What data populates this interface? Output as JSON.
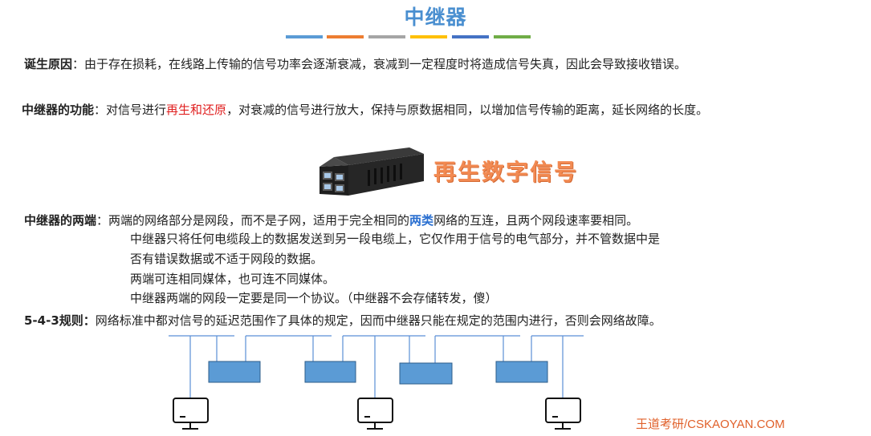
{
  "title": "中继器",
  "stripe_colors": [
    "#5b9bd5",
    "#ed7d31",
    "#a5a5a5",
    "#ffc000",
    "#4472c4",
    "#70ad47"
  ],
  "origin": {
    "label": "诞生原因",
    "sep": "：",
    "text": "由于存在损耗，在线路上传输的信号功率会逐渐衰减，衰减到一定程度时将造成信号失真，因此会导致接收错误。"
  },
  "function": {
    "label": "中继器的功能",
    "sep": "：",
    "text_before": "对信号进行",
    "highlight": "再生和还原",
    "text_after": "，对衰减的信号进行放大，保持与原数据相同，以增加信号传输的距离，延长网络的长度。"
  },
  "regen_label": "再生数字信号",
  "ends": {
    "label": "中继器的两端",
    "sep": "：",
    "line1_before": "两端的网络部分是网段，而不是子网，适用于完全相同的",
    "line1_highlight": "两类",
    "line1_after": "网络的互连，且两个网段速率要相同。",
    "line2": "中继器只将任何电缆段上的数据发送到另一段电缆上，它仅作用于信号的电气部分，并不管数据中是",
    "line3": "否有错误数据或不适于网段的数据。",
    "line4": "两端可连相同媒体，也可连不同媒体。",
    "line5": "中继器两端的网段一定要是同一个协议。（中继器不会存储转发，傻）"
  },
  "rule": {
    "label": "5-4-3规则：",
    "text": "网络标准中都对信号的延迟范围作了具体的规定，因而中继器只能在规定的范围内进行，否则会网络故障。"
  },
  "credit": "王道考研/CSKAOYAN.COM"
}
